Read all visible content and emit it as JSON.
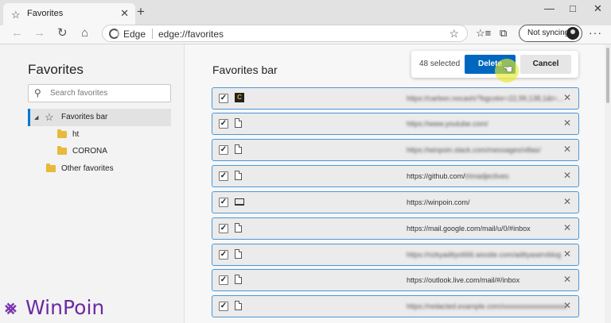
{
  "tab": {
    "title": "Favorites",
    "icon": "favorites-star-icon"
  },
  "window": {
    "minimize": "—",
    "maximize": "□",
    "close": "✕"
  },
  "address": {
    "brand": "Edge",
    "separator": "|",
    "url": "edge://favorites"
  },
  "sync": {
    "label": "Not syncing"
  },
  "sidebar": {
    "title": "Favorites",
    "search_placeholder": "Search favorites",
    "tree": [
      {
        "label": "Favorites bar",
        "selected": true
      },
      {
        "label": "ht"
      },
      {
        "label": "CORONA"
      },
      {
        "label": "Other favorites"
      }
    ]
  },
  "main": {
    "title": "Favorites bar",
    "selected_count": "48 selected",
    "delete_label": "Delete",
    "cancel_label": "Cancel"
  },
  "rows": [
    {
      "url": "https://carbon.nocash/?bgcolor=22,99,138,1&t=...",
      "icon": "dark-favicon",
      "blurred": true
    },
    {
      "url": "https://www.youtube.com/",
      "icon": "page-icon",
      "blurred": true
    },
    {
      "url": "https://winpoin.slack.com/messages/villas/",
      "icon": "page-icon",
      "blurred": true
    },
    {
      "url": "https://github.com/",
      "icon": "page-icon",
      "blurred": false,
      "blurred_suffix": "trimadjectives"
    },
    {
      "url": "https://winpoin.com/",
      "icon": "laptop-favicon",
      "blurred": false
    },
    {
      "url": "https://mail.google.com/mail/u/0/#inbox",
      "icon": "page-icon",
      "blurred": false
    },
    {
      "url": "https://rizkyadityo666.wixsite.com/adityaservblog",
      "icon": "page-icon",
      "blurred": true
    },
    {
      "url": "https://outlook.live.com/mail/#/inbox",
      "icon": "page-icon",
      "blurred": false
    },
    {
      "url": "https://redacted.example.com/xxxxxxxxxxxxxxxxxx",
      "icon": "page-icon",
      "blurred": true
    }
  ],
  "watermark": {
    "text": "WinPoin"
  },
  "colors": {
    "accent": "#0067c0",
    "row_border": "#4b97d8",
    "watermark": "#6a2aa3"
  }
}
